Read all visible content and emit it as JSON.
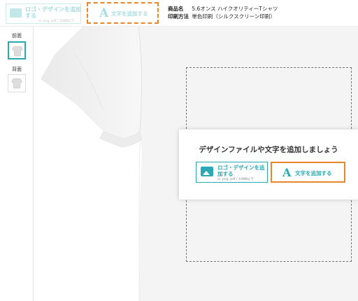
{
  "toolbar": {
    "add_logo_label": "ロゴ・デザインを追加する",
    "add_logo_sub": "ai .png .pdf / 10MB以下",
    "add_text_label": "文字を追加する",
    "text_icon_glyph": "A"
  },
  "product": {
    "name_key": "商品名",
    "name_value": "5.6オンス ハイクオリティーTシャツ",
    "method_key": "印刷方法",
    "method_value": "単色印刷（シルクスクリーン印刷）"
  },
  "sides": {
    "front_label": "前面",
    "back_label": "背面"
  },
  "prompt": {
    "title": "デザインファイルや文字を追加しましょう",
    "add_logo_label": "ロゴ・デザインを追加する",
    "add_logo_sub": "ai .png .pdf / 10MB以下",
    "add_text_label": "文字を追加する",
    "text_icon_glyph": "A"
  },
  "colors": {
    "accent": "#2aa8b3",
    "highlight": "#e8862a"
  }
}
